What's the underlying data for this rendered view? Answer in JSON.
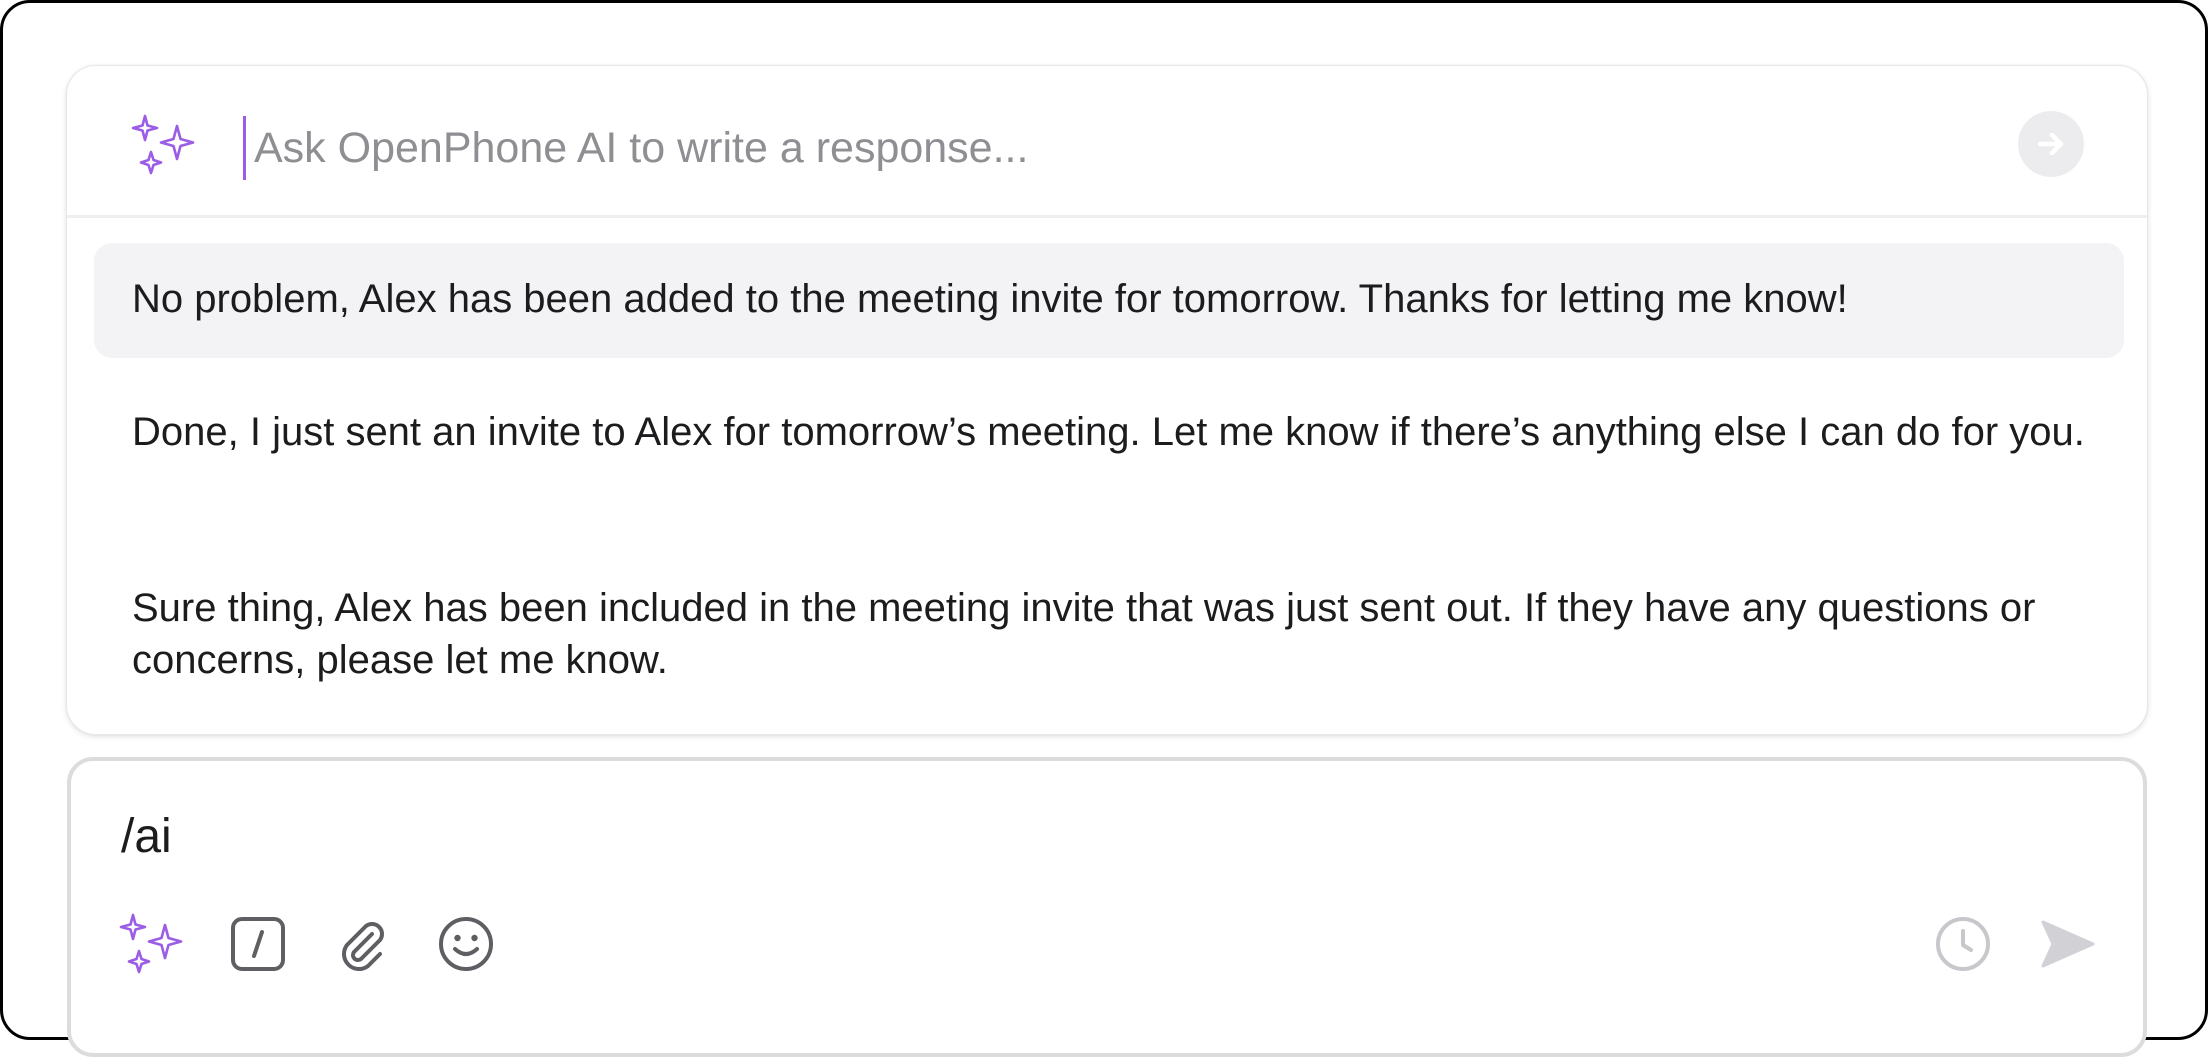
{
  "ai_prompt": {
    "placeholder": "Ask OpenPhone AI to write a response...",
    "value": ""
  },
  "suggestions": [
    {
      "text": "No problem, Alex has been added to the meeting invite for tomorrow. Thanks for letting me know!",
      "selected": true
    },
    {
      "text": "Done, I just sent an invite to Alex for tomorrow’s meeting. Let me know if there’s anything else I can do for you.",
      "selected": false
    },
    {
      "text": "Sure thing, Alex has been included in the meeting invite that was just sent out. If they have any questions or concerns, please let me know.",
      "selected": false
    }
  ],
  "composer": {
    "text": "/ai"
  },
  "icons": {
    "sparkle": "sparkles-icon",
    "submit": "arrow-right-circle-icon",
    "slash": "slash-command-icon",
    "attach": "paperclip-icon",
    "emoji": "emoji-icon",
    "schedule": "clock-icon",
    "send": "send-icon"
  },
  "colors": {
    "accent": "#9b5de5",
    "icon_gray": "#5e5e63",
    "disabled_gray": "#c7c7cc"
  }
}
